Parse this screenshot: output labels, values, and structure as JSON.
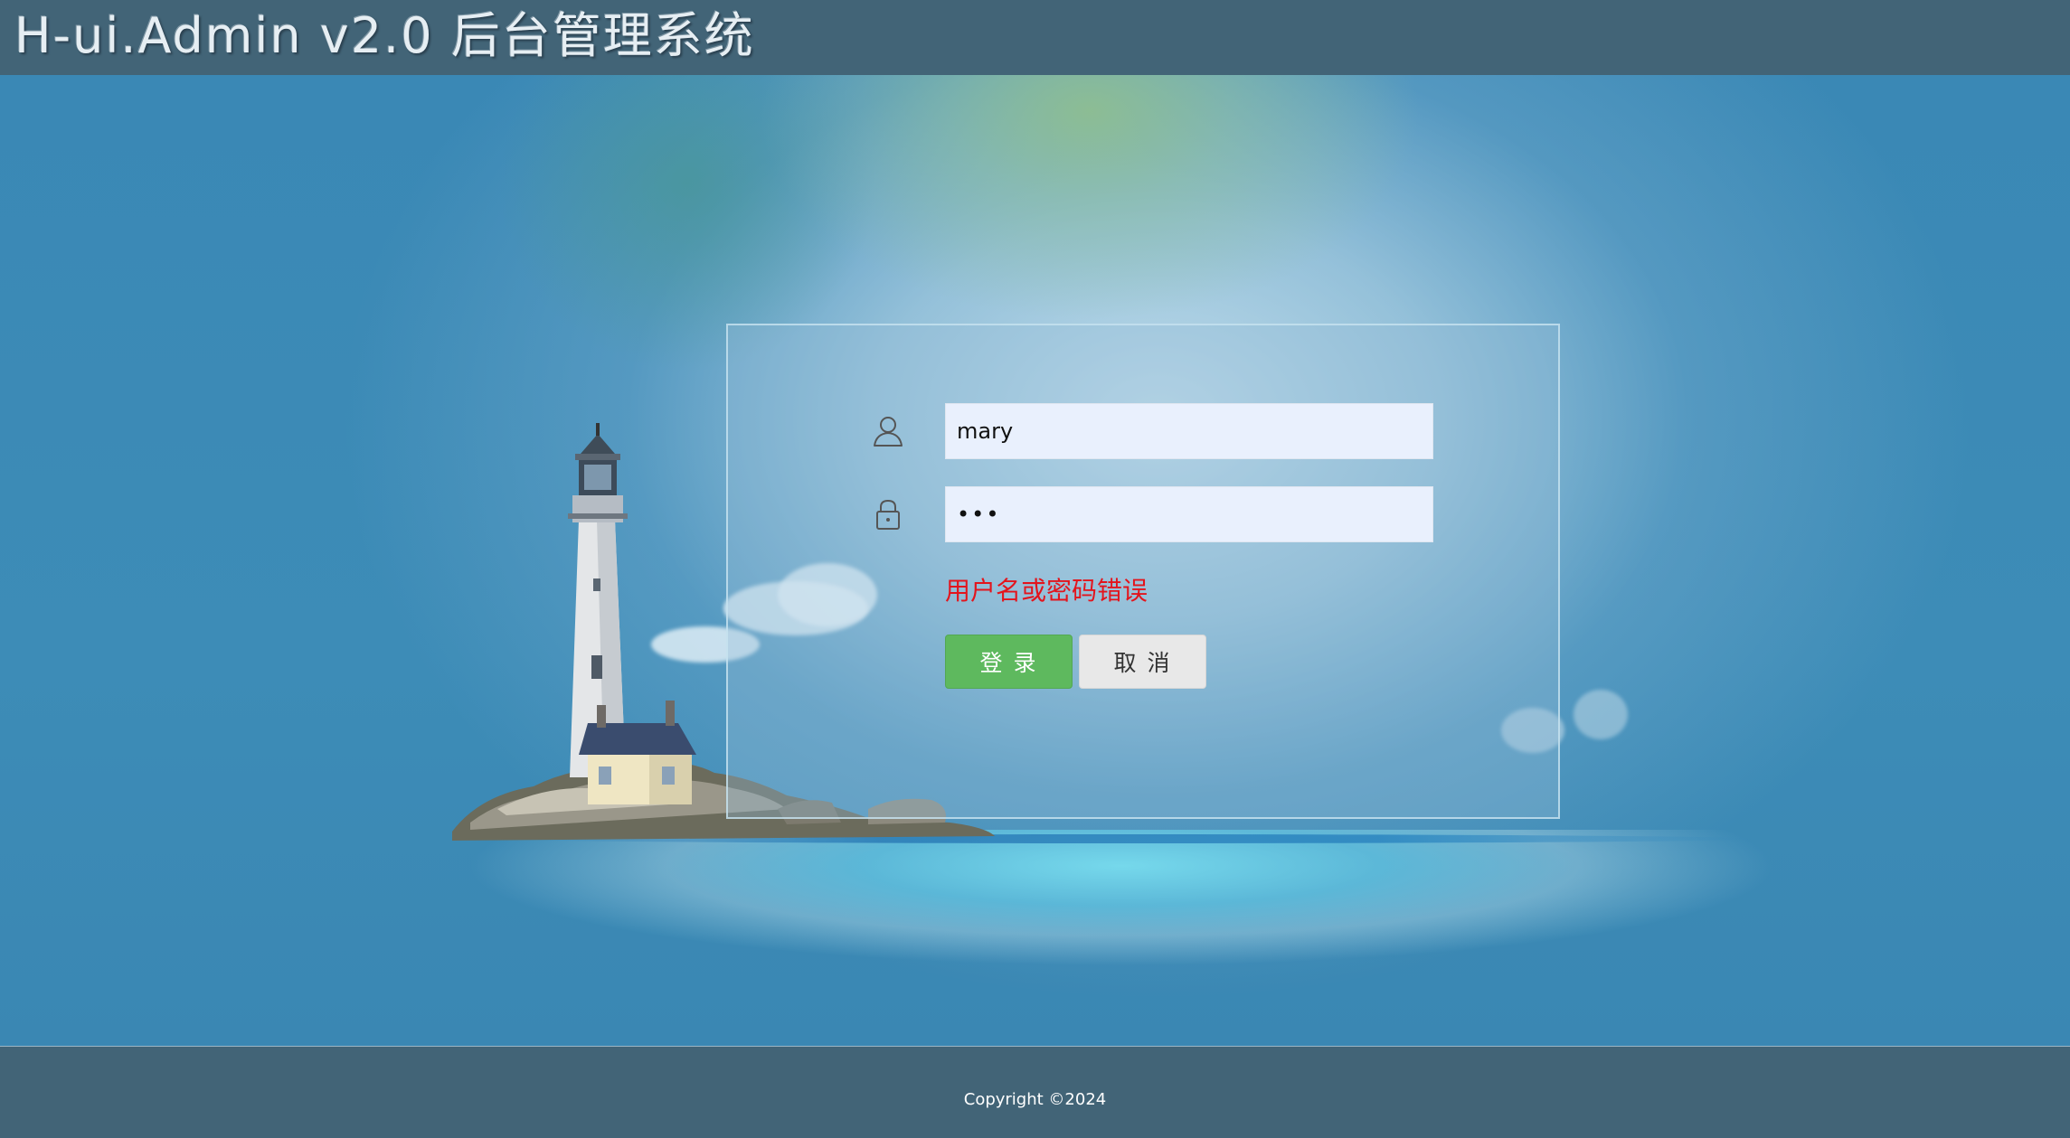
{
  "header": {
    "logo_text": "H-ui.Admin v2.0 后台管理系统"
  },
  "login": {
    "username_icon": "user-icon",
    "username_value": "mary",
    "password_icon": "lock-icon",
    "password_value": "•••",
    "error_text": "用户名或密码错误",
    "login_button": "登  录",
    "cancel_button": "取  消"
  },
  "footer": {
    "copyright": "Copyright ©2024"
  },
  "colors": {
    "header_bg": "#426477",
    "login_button_bg": "#5eb95e",
    "cancel_button_bg": "#e8e8e8",
    "error_text": "#e3141c",
    "input_bg": "#e9f0fd"
  }
}
